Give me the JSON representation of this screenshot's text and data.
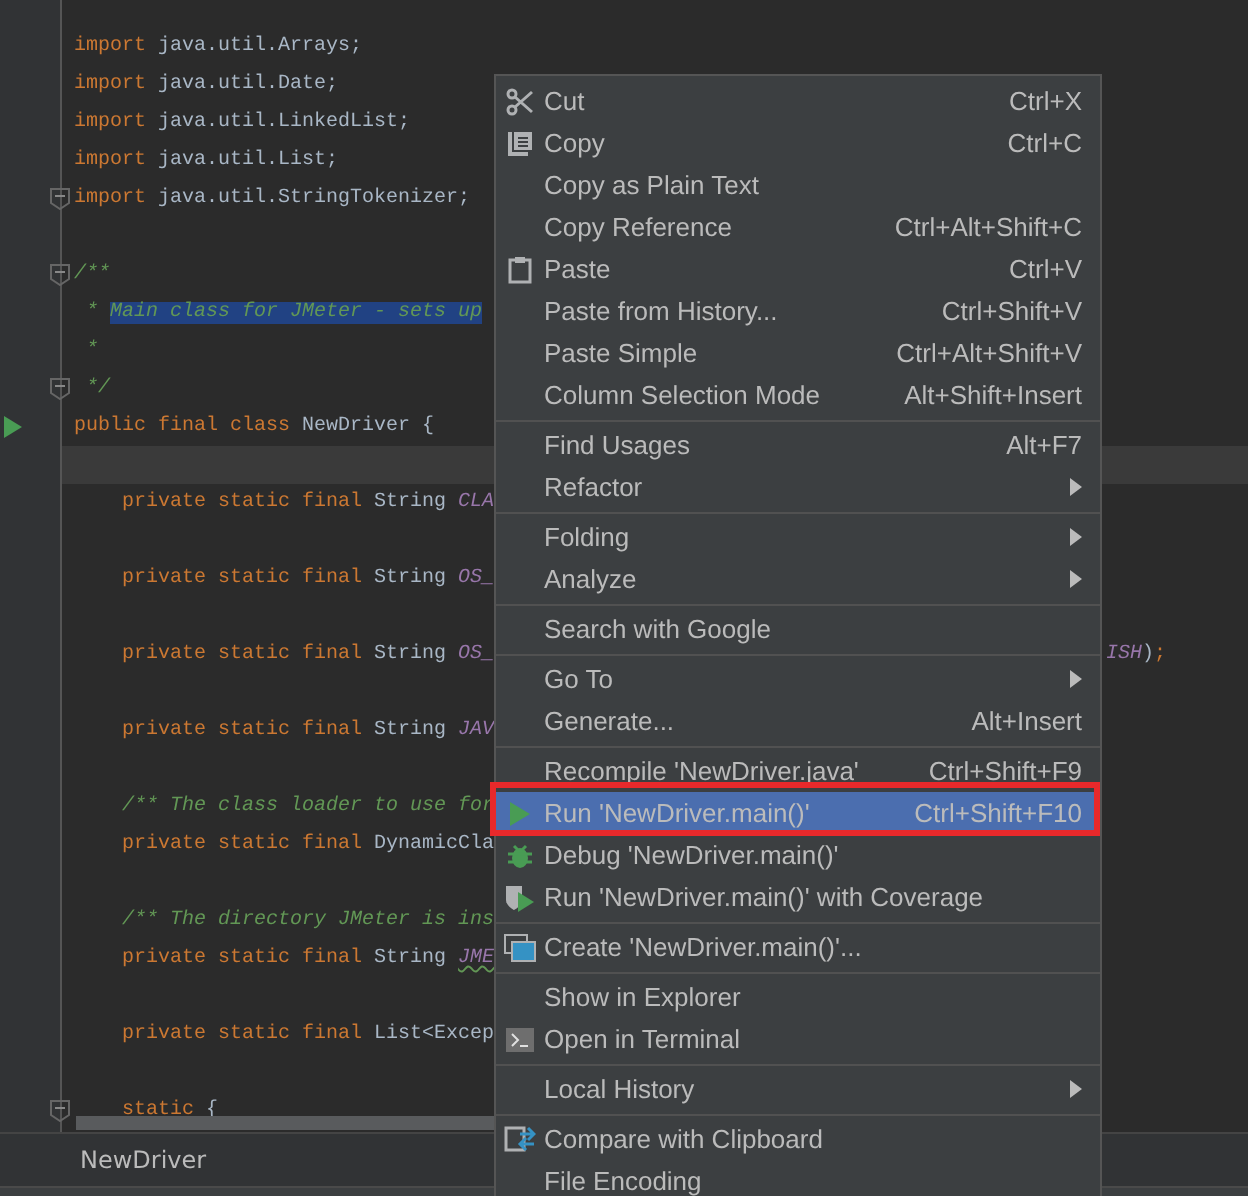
{
  "editor": {
    "lines": [
      {
        "segments": [
          {
            "kind": "keyword",
            "text": "import"
          },
          {
            "kind": "plain",
            "text": " java.util.Arrays;"
          }
        ],
        "current": false
      },
      {
        "segments": [
          {
            "kind": "keyword",
            "text": "import"
          },
          {
            "kind": "plain",
            "text": " java.util.Date;"
          }
        ],
        "current": false
      },
      {
        "segments": [
          {
            "kind": "keyword",
            "text": "import"
          },
          {
            "kind": "plain",
            "text": " java.util.LinkedList;"
          }
        ],
        "current": false
      },
      {
        "segments": [
          {
            "kind": "keyword",
            "text": "import"
          },
          {
            "kind": "plain",
            "text": " java.util.List;"
          }
        ],
        "current": false
      },
      {
        "segments": [
          {
            "kind": "keyword",
            "text": "import"
          },
          {
            "kind": "plain",
            "text": " java.util.StringTokenizer;"
          }
        ],
        "kind": "fold",
        "current": false
      },
      {
        "current": false
      },
      {
        "segments": [
          {
            "kind": "comment",
            "text": "/**"
          }
        ],
        "kind": "fold",
        "current": false
      },
      {
        "segments": [
          {
            "kind": "comment",
            "text": " * "
          },
          {
            "kind": "selection",
            "text": "Main class for JMeter - sets up"
          }
        ],
        "current": false
      },
      {
        "segments": [
          {
            "kind": "comment",
            "text": " *"
          }
        ],
        "current": false
      },
      {
        "segments": [
          {
            "kind": "comment",
            "text": " */"
          }
        ],
        "kind": "fold",
        "current": false
      },
      {
        "segments": [
          {
            "kind": "keyword",
            "text": "public final class"
          },
          {
            "kind": "plain",
            "text": " NewDriver {"
          }
        ],
        "kind": "run",
        "current": false
      },
      {
        "current": true
      },
      {
        "segments": [
          {
            "kind": "keyword",
            "text": "    private static final"
          },
          {
            "kind": "plain",
            "text": " String "
          },
          {
            "kind": "constant",
            "text": "CLA"
          }
        ],
        "current": false
      },
      {
        "current": false
      },
      {
        "segments": [
          {
            "kind": "keyword",
            "text": "    private static final"
          },
          {
            "kind": "plain",
            "text": " String "
          },
          {
            "kind": "constant",
            "text": "OS_"
          }
        ],
        "current": false
      },
      {
        "current": false
      },
      {
        "segments": [
          {
            "kind": "keyword",
            "text": "    private static final"
          },
          {
            "kind": "plain",
            "text": " String "
          },
          {
            "kind": "constant",
            "text": "OS_"
          }
        ],
        "tail": [
          {
            "kind": "constant",
            "text": "ISH"
          },
          {
            "kind": "plain",
            "text": ")"
          },
          {
            "kind": "keyword",
            "text": ";"
          }
        ],
        "current": false
      },
      {
        "current": false
      },
      {
        "segments": [
          {
            "kind": "keyword",
            "text": "    private static final"
          },
          {
            "kind": "plain",
            "text": " String "
          },
          {
            "kind": "constant",
            "text": "JAV"
          }
        ],
        "current": false
      },
      {
        "current": false
      },
      {
        "segments": [
          {
            "kind": "comment",
            "text": "    /** The class loader to use for"
          }
        ],
        "current": false
      },
      {
        "segments": [
          {
            "kind": "keyword",
            "text": "    private static final"
          },
          {
            "kind": "plain",
            "text": " DynamicCla"
          }
        ],
        "current": false
      },
      {
        "current": false
      },
      {
        "segments": [
          {
            "kind": "comment",
            "text": "    /** The directory JMeter is ins"
          }
        ],
        "current": false
      },
      {
        "segments": [
          {
            "kind": "keyword",
            "text": "    private static final"
          },
          {
            "kind": "plain",
            "text": " String "
          },
          {
            "kind": "warning",
            "text": "JME"
          }
        ],
        "current": false
      },
      {
        "current": false
      },
      {
        "segments": [
          {
            "kind": "keyword",
            "text": "    private static final"
          },
          {
            "kind": "plain",
            "text": " List<Excep"
          }
        ],
        "current": false
      },
      {
        "current": false
      },
      {
        "segments": [
          {
            "kind": "keyword",
            "text": "    static"
          },
          {
            "kind": "plain",
            "text": " {"
          }
        ],
        "kind": "fold",
        "current": false
      }
    ]
  },
  "context_menu": {
    "items": [
      {
        "label": "Cut",
        "shortcut": "Ctrl+X",
        "kind": "scissors",
        "submenu": false,
        "selected": false
      },
      {
        "label": "Copy",
        "shortcut": "Ctrl+C",
        "kind": "copy",
        "submenu": false,
        "selected": false
      },
      {
        "label": "Copy as Plain Text",
        "submenu": false,
        "selected": false
      },
      {
        "label": "Copy Reference",
        "shortcut": "Ctrl+Alt+Shift+C",
        "submenu": false,
        "selected": false
      },
      {
        "label": "Paste",
        "shortcut": "Ctrl+V",
        "kind": "clipboard",
        "submenu": false,
        "selected": false
      },
      {
        "label": "Paste from History...",
        "shortcut": "Ctrl+Shift+V",
        "submenu": false,
        "selected": false
      },
      {
        "label": "Paste Simple",
        "shortcut": "Ctrl+Alt+Shift+V",
        "submenu": false,
        "selected": false
      },
      {
        "label": "Column Selection Mode",
        "shortcut": "Alt+Shift+Insert",
        "submenu": false,
        "selected": false
      },
      {
        "kind": "separator"
      },
      {
        "label": "Find Usages",
        "shortcut": "Alt+F7",
        "submenu": false,
        "selected": false
      },
      {
        "label": "Refactor",
        "submenu": true,
        "selected": false
      },
      {
        "kind": "separator"
      },
      {
        "label": "Folding",
        "submenu": true,
        "selected": false
      },
      {
        "label": "Analyze",
        "submenu": true,
        "selected": false
      },
      {
        "kind": "separator"
      },
      {
        "label": "Search with Google",
        "submenu": false,
        "selected": false
      },
      {
        "kind": "separator"
      },
      {
        "label": "Go To",
        "submenu": true,
        "selected": false
      },
      {
        "label": "Generate...",
        "shortcut": "Alt+Insert",
        "submenu": false,
        "selected": false
      },
      {
        "kind": "separator"
      },
      {
        "label": "Recompile 'NewDriver.java'",
        "shortcut": "Ctrl+Shift+F9",
        "submenu": false,
        "selected": false
      },
      {
        "label": "Run 'NewDriver.main()'",
        "shortcut": "Ctrl+Shift+F10",
        "kind": "run",
        "submenu": false,
        "selected": true
      },
      {
        "label": "Debug 'NewDriver.main()'",
        "kind": "bug",
        "submenu": false,
        "selected": false
      },
      {
        "label": "Run 'NewDriver.main()' with Coverage",
        "kind": "coverage",
        "submenu": false,
        "selected": false
      },
      {
        "kind": "separator"
      },
      {
        "label": "Create 'NewDriver.main()'...",
        "kind": "window",
        "submenu": false,
        "selected": false
      },
      {
        "kind": "separator"
      },
      {
        "label": "Show in Explorer",
        "submenu": false,
        "selected": false
      },
      {
        "label": "Open in Terminal",
        "kind": "terminal",
        "submenu": false,
        "selected": false
      },
      {
        "kind": "separator"
      },
      {
        "label": "Local History",
        "submenu": true,
        "selected": false
      },
      {
        "kind": "separator"
      },
      {
        "label": "Compare with Clipboard",
        "kind": "compare",
        "submenu": false,
        "selected": false
      },
      {
        "label": "File Encoding",
        "submenu": false,
        "selected": false
      }
    ]
  },
  "status_bar": {
    "tab": "NewDriver"
  }
}
